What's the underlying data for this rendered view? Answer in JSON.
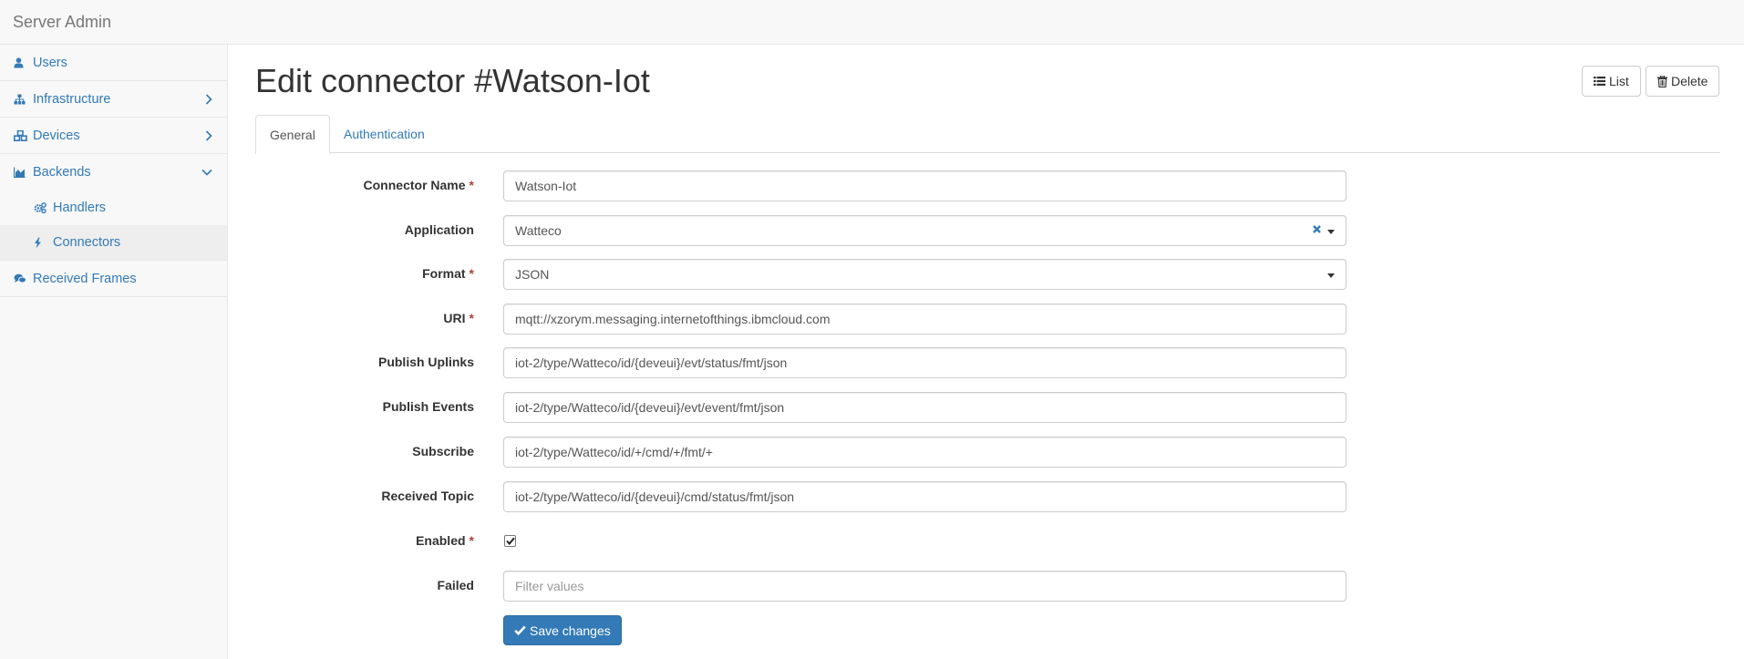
{
  "app": {
    "brand": "Server Admin"
  },
  "sidebar": {
    "items": [
      {
        "label": "Users",
        "icon": "user-icon"
      },
      {
        "label": "Infrastructure",
        "icon": "sitemap-icon",
        "chevron": "right"
      },
      {
        "label": "Devices",
        "icon": "cubes-icon",
        "chevron": "right"
      },
      {
        "label": "Backends",
        "icon": "area-chart-icon",
        "chevron": "down",
        "children": [
          {
            "label": "Handlers",
            "icon": "gears-icon"
          },
          {
            "label": "Connectors",
            "icon": "bolt-icon",
            "active": true
          }
        ]
      },
      {
        "label": "Received Frames",
        "icon": "comments-icon"
      }
    ]
  },
  "page": {
    "title": "Edit connector #Watson-Iot",
    "actions": {
      "list_label": "List",
      "delete_label": "Delete"
    },
    "tabs": [
      {
        "label": "General",
        "active": true
      },
      {
        "label": "Authentication",
        "active": false
      }
    ]
  },
  "form": {
    "required_mark": "*",
    "connector_name": {
      "label": "Connector Name",
      "value": "Watson-Iot",
      "required": true
    },
    "application": {
      "label": "Application",
      "value": "Watteco"
    },
    "format": {
      "label": "Format",
      "value": "JSON",
      "required": true
    },
    "uri": {
      "label": "URI",
      "value": "mqtt://xzorym.messaging.internetofthings.ibmcloud.com",
      "required": true
    },
    "publish_uplinks": {
      "label": "Publish Uplinks",
      "value": "iot-2/type/Watteco/id/{deveui}/evt/status/fmt/json"
    },
    "publish_events": {
      "label": "Publish Events",
      "value": "iot-2/type/Watteco/id/{deveui}/evt/event/fmt/json"
    },
    "subscribe": {
      "label": "Subscribe",
      "value": "iot-2/type/Watteco/id/+/cmd/+/fmt/+"
    },
    "received_topic": {
      "label": "Received Topic",
      "value": "iot-2/type/Watteco/id/{deveui}/cmd/status/fmt/json"
    },
    "enabled": {
      "label": "Enabled",
      "checked": true,
      "required": true
    },
    "failed": {
      "label": "Failed",
      "value": "",
      "placeholder": "Filter values"
    },
    "save_label": "Save changes"
  },
  "colors": {
    "link": "#337ab7",
    "primary": "#337ab7",
    "required": "#a94442"
  }
}
